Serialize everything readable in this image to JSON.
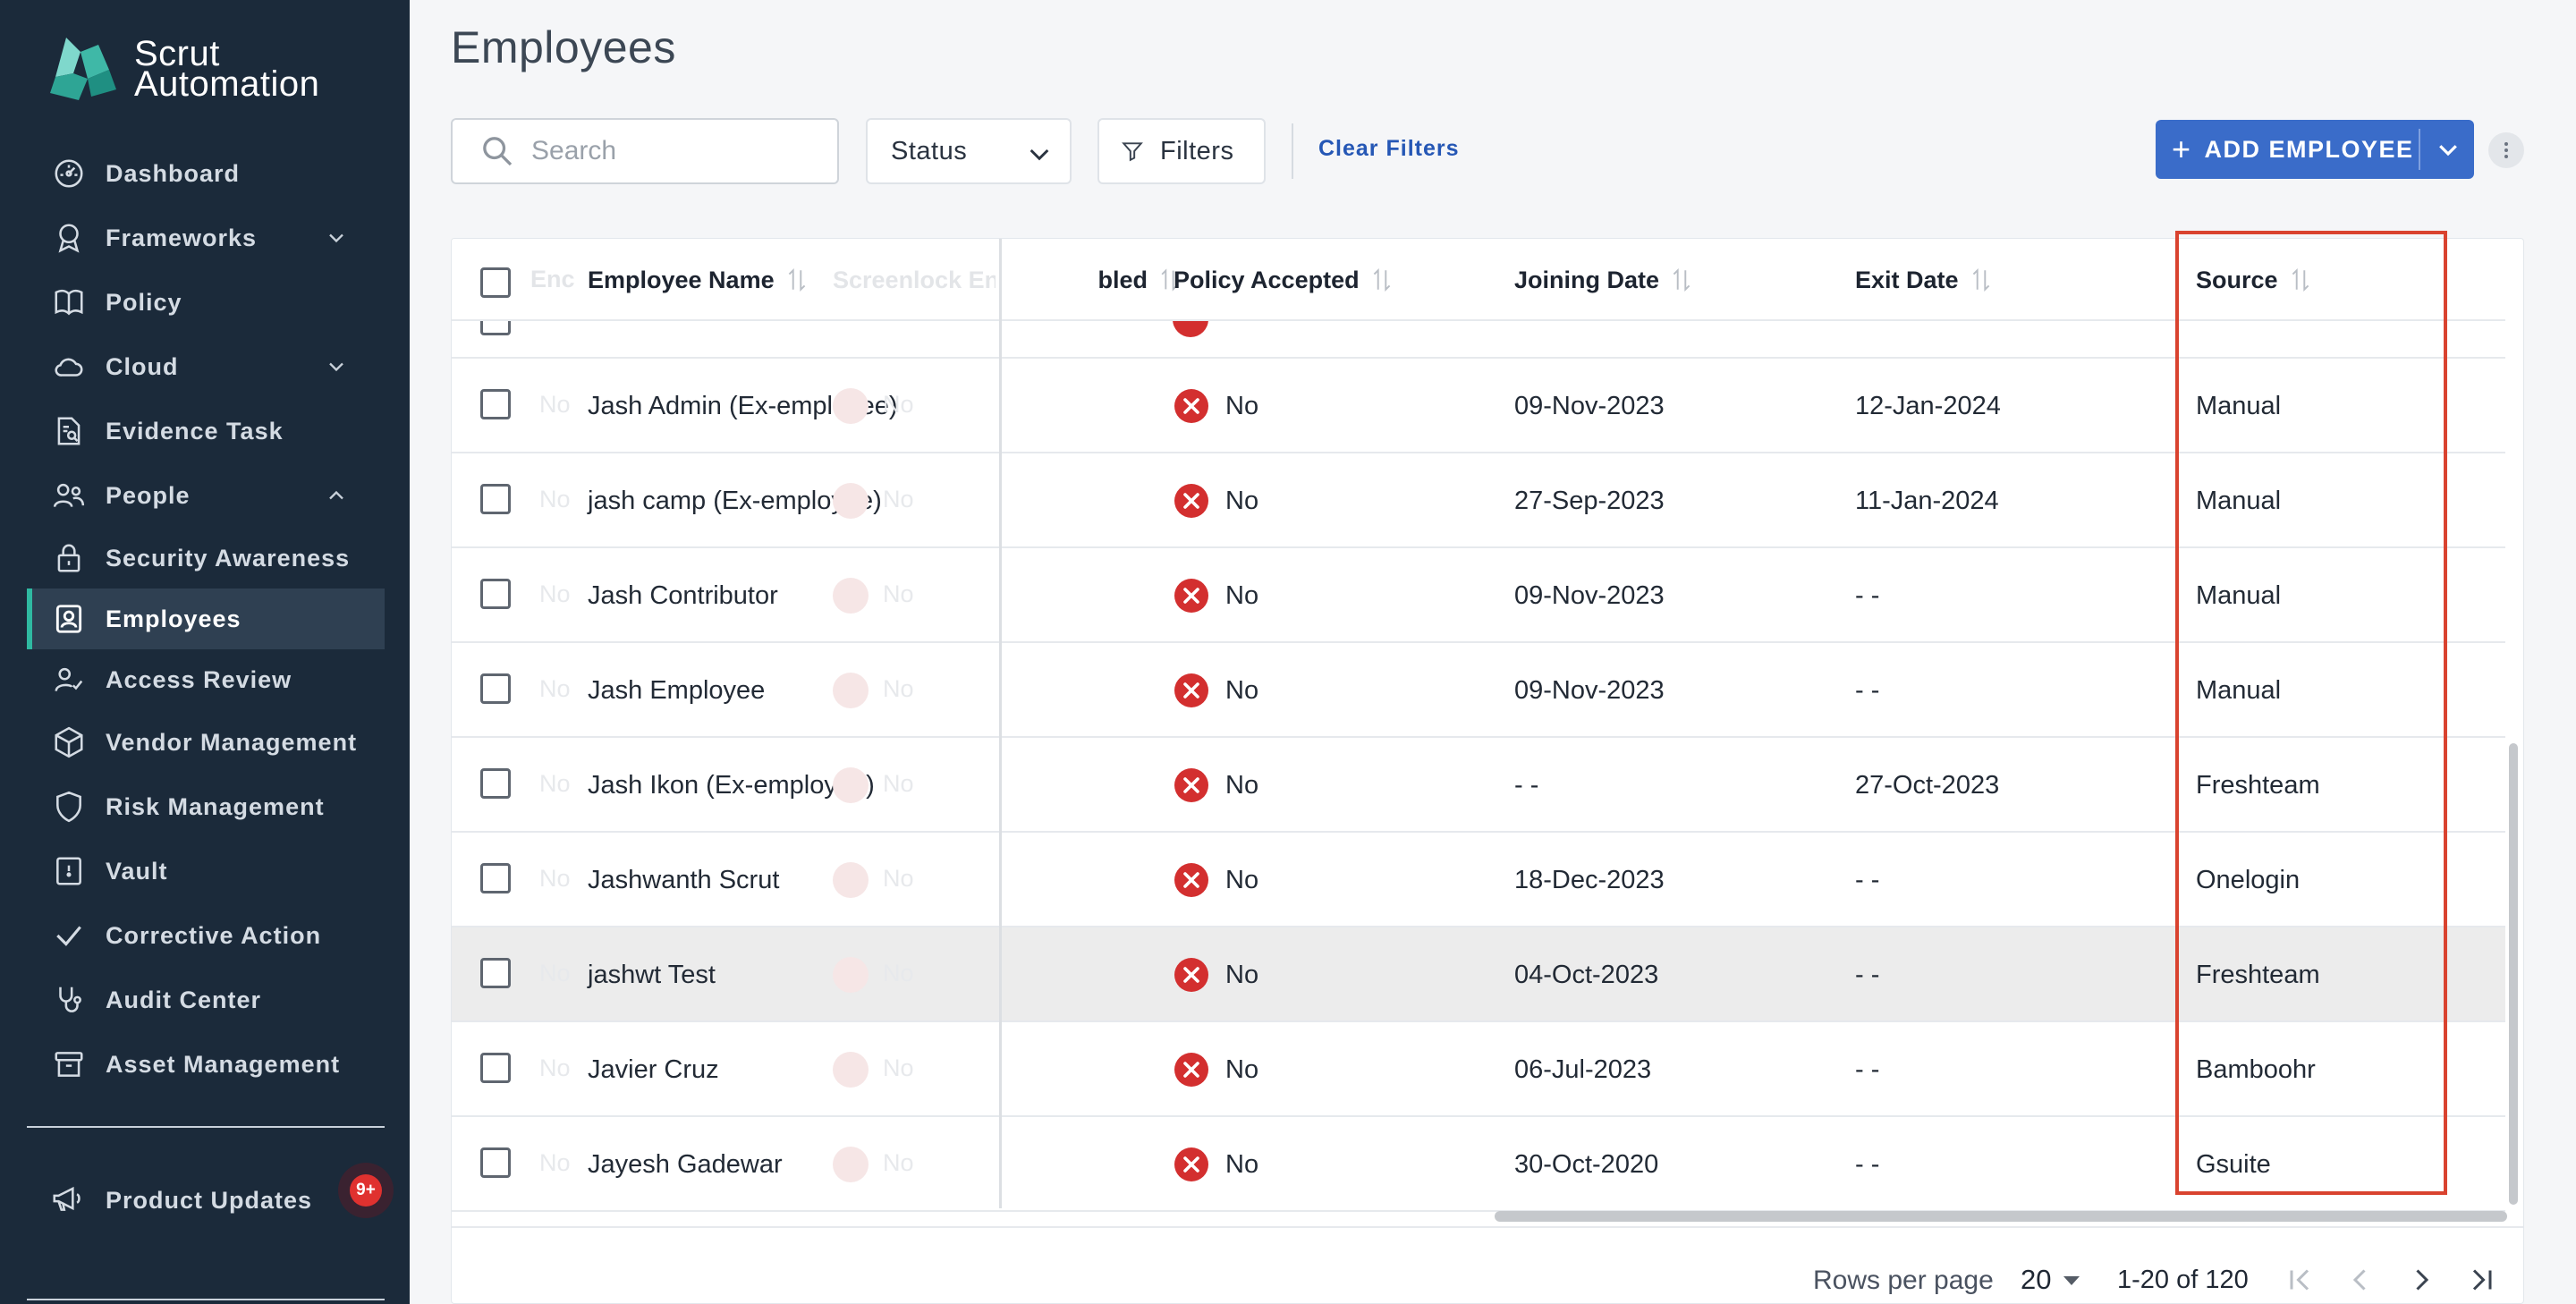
{
  "app": {
    "brand_line1": "Scrut",
    "brand_line2": "Automation"
  },
  "sidebar": {
    "items": [
      {
        "label": "Dashboard",
        "icon": "dashboard-icon"
      },
      {
        "label": "Frameworks",
        "icon": "award-icon",
        "expandable": true
      },
      {
        "label": "Policy",
        "icon": "book-icon"
      },
      {
        "label": "Cloud",
        "icon": "cloud-icon",
        "expandable": true
      },
      {
        "label": "Evidence Task",
        "icon": "document-search-icon"
      },
      {
        "label": "People",
        "icon": "users-icon",
        "expanded": true
      },
      {
        "label": "Security Awareness",
        "icon": "lock-icon"
      },
      {
        "label": "Employees",
        "icon": "employee-badge-icon",
        "active": true
      },
      {
        "label": "Access Review",
        "icon": "user-check-icon"
      },
      {
        "label": "Vendor Management",
        "icon": "box-icon"
      },
      {
        "label": "Risk Management",
        "icon": "shield-icon"
      },
      {
        "label": "Vault",
        "icon": "vault-icon"
      },
      {
        "label": "Corrective Action",
        "icon": "check-icon"
      },
      {
        "label": "Audit Center",
        "icon": "stethoscope-icon"
      },
      {
        "label": "Asset Management",
        "icon": "archive-icon"
      }
    ],
    "product_updates": {
      "label": "Product Updates",
      "badge": "9+"
    },
    "accent_color": "#2fb9a1"
  },
  "header": {
    "title": "Employees"
  },
  "toolbar": {
    "search_placeholder": "Search",
    "status_label": "Status",
    "filters_label": "Filters",
    "clear_filters_label": "Clear Filters",
    "add_employee_label": "ADD EMPLOYEE",
    "add_button_color": "#3a6cc9"
  },
  "table": {
    "columns": {
      "employee_name": "Employee Name",
      "screenlock": "Screenlock Enabled",
      "policy_accepted": "Policy Accepted",
      "joining_date": "Joining Date",
      "exit_date": "Exit Date",
      "source": "Source"
    },
    "rows": [
      {
        "name": "Jash Admin (Ex-employee)",
        "policy": "No",
        "joining": "09-Nov-2023",
        "exit": "12-Jan-2024",
        "source": "Manual"
      },
      {
        "name": "jash camp (Ex-employee)",
        "policy": "No",
        "joining": "27-Sep-2023",
        "exit": "11-Jan-2024",
        "source": "Manual"
      },
      {
        "name": "Jash Contributor",
        "policy": "No",
        "joining": "09-Nov-2023",
        "exit": "- -",
        "source": "Manual"
      },
      {
        "name": "Jash Employee",
        "policy": "No",
        "joining": "09-Nov-2023",
        "exit": "- -",
        "source": "Manual"
      },
      {
        "name": "Jash Ikon (Ex-employee)",
        "policy": "No",
        "joining": "- -",
        "exit": "27-Oct-2023",
        "source": "Freshteam"
      },
      {
        "name": "Jashwanth Scrut",
        "policy": "No",
        "joining": "18-Dec-2023",
        "exit": "- -",
        "source": "Onelogin"
      },
      {
        "name": "jashwt Test",
        "policy": "No",
        "joining": "04-Oct-2023",
        "exit": "- -",
        "source": "Freshteam",
        "highlighted": true
      },
      {
        "name": "Javier Cruz",
        "policy": "No",
        "joining": "06-Jul-2023",
        "exit": "- -",
        "source": "Bamboohr"
      },
      {
        "name": "Jayesh Gadewar",
        "policy": "No",
        "joining": "30-Oct-2020",
        "exit": "- -",
        "source": "Gsuite"
      }
    ],
    "ghost_text": {
      "col_fragment": "Enc",
      "no_fragment": "No"
    },
    "status_no_color": "#d32f2f",
    "highlight_color": "#d9432f"
  },
  "pagination": {
    "rows_per_page_label": "Rows per page",
    "rows_per_page_value": "20",
    "range_label": "1-20 of 120"
  }
}
